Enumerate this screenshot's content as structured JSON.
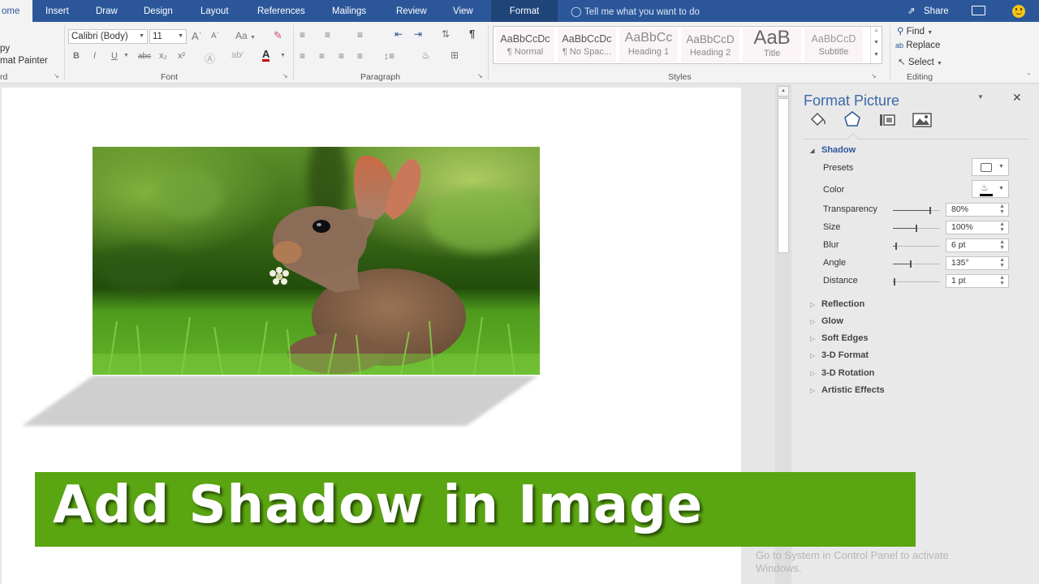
{
  "tabs": {
    "home": "ome",
    "insert": "Insert",
    "draw": "Draw",
    "design": "Design",
    "layout": "Layout",
    "references": "References",
    "mailings": "Mailings",
    "review": "Review",
    "view": "View",
    "format": "Format"
  },
  "tell_me": "Tell me what you want to do",
  "share": "Share",
  "clipboard": {
    "copy": "py",
    "format_painter": "mat Painter",
    "group_label": "rd"
  },
  "font": {
    "name": "Calibri (Body)",
    "size": "11",
    "change_case": "Aa",
    "bold": "B",
    "italic": "I",
    "underline": "U",
    "strikethrough": "abc",
    "subscript": "x₂",
    "superscript": "x²",
    "group_label": "Font",
    "font_color": "#c00000"
  },
  "paragraph": {
    "group_label": "Paragraph",
    "pilcrow": "¶"
  },
  "styles": {
    "group_label": "Styles",
    "items": [
      {
        "preview": "AaBbCcDc",
        "name": "¶ Normal"
      },
      {
        "preview": "AaBbCcDc",
        "name": "¶ No Spac..."
      },
      {
        "preview": "AaBbCc",
        "name": "Heading 1"
      },
      {
        "preview": "AaBbCcD",
        "name": "Heading 2"
      },
      {
        "preview": "AaB",
        "name": "Title"
      },
      {
        "preview": "AaBbCcD",
        "name": "Subtitle"
      }
    ]
  },
  "editing": {
    "find": "Find",
    "replace": "Replace",
    "select": "Select",
    "group_label": "Editing"
  },
  "pane": {
    "title": "Format Picture",
    "tabs": [
      "fill-line",
      "effects",
      "layout-properties",
      "picture"
    ],
    "shadow_section": "Shadow",
    "presets_label": "Presets",
    "color_label": "Color",
    "fields": [
      {
        "label": "Transparency",
        "value": "80%",
        "slider": 0.8
      },
      {
        "label": "Size",
        "value": "100%",
        "slider": 0.5
      },
      {
        "label": "Blur",
        "value": "6 pt",
        "slider": 0.06
      },
      {
        "label": "Angle",
        "value": "135°",
        "slider": 0.375
      },
      {
        "label": "Distance",
        "value": "1 pt",
        "slider": 0.01
      }
    ],
    "sections": [
      "Reflection",
      "Glow",
      "Soft Edges",
      "3-D Format",
      "3-D Rotation",
      "Artistic Effects"
    ]
  },
  "banner": {
    "text": "Add Shadow in Image",
    "color": "#5aa512"
  },
  "activation": {
    "line1": "Go to System in Control Panel to activate",
    "line2": "Windows."
  }
}
